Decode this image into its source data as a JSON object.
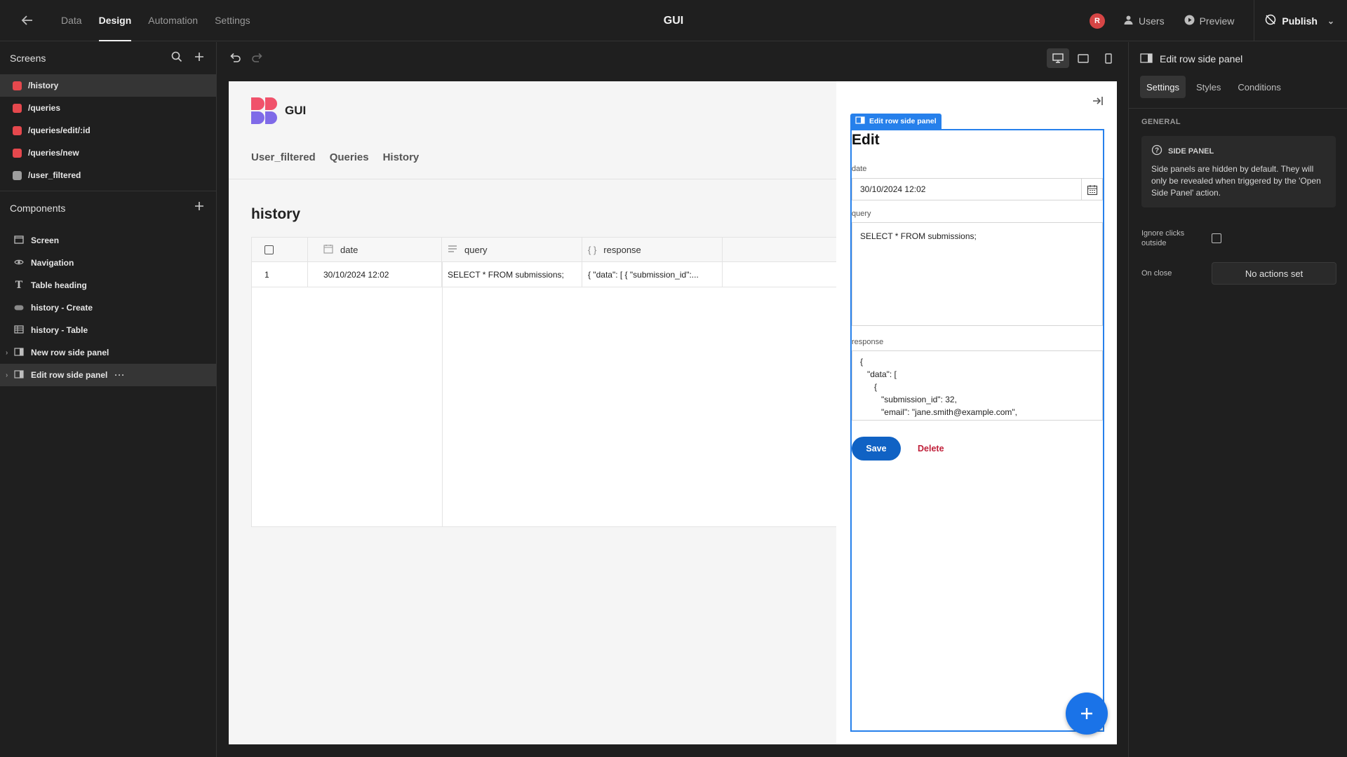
{
  "topbar": {
    "tabs": [
      "Data",
      "Design",
      "Automation",
      "Settings"
    ],
    "active_tab": "Design",
    "app_title": "GUI",
    "avatar_initial": "R",
    "users_label": "Users",
    "preview_label": "Preview",
    "publish_label": "Publish"
  },
  "left": {
    "screens_title": "Screens",
    "screens": [
      {
        "label": "/history",
        "color": "#e5484d",
        "active": true
      },
      {
        "label": "/queries",
        "color": "#e5484d",
        "active": false
      },
      {
        "label": "/queries/edit/:id",
        "color": "#e5484d",
        "active": false
      },
      {
        "label": "/queries/new",
        "color": "#e5484d",
        "active": false
      },
      {
        "label": "/user_filtered",
        "color": "#9e9e9e",
        "active": false
      }
    ],
    "components_title": "Components",
    "components": [
      {
        "label": "Screen",
        "icon": "screen-icon"
      },
      {
        "label": "Navigation",
        "icon": "eye-icon"
      },
      {
        "label": "Table heading",
        "icon": "text-icon"
      },
      {
        "label": "history - Create",
        "icon": "button-icon"
      },
      {
        "label": "history - Table",
        "icon": "table-icon"
      },
      {
        "label": "New row side panel",
        "icon": "panel-icon"
      },
      {
        "label": "Edit row side panel",
        "icon": "panel-icon"
      }
    ]
  },
  "app": {
    "brand": "GUI",
    "nav": [
      "User_filtered",
      "Queries",
      "History"
    ],
    "page_title": "history",
    "table": {
      "columns": [
        "date",
        "query",
        "response"
      ],
      "rows": [
        {
          "index": "1",
          "date": "30/10/2024 12:02",
          "query": "SELECT * FROM submissions;",
          "response": "{ \"data\": [ { \"submission_id\":..."
        }
      ]
    }
  },
  "panel": {
    "tag": "Edit row side panel",
    "title": "Edit",
    "date_label": "date",
    "date_value": "30/10/2024 12:02",
    "query_label": "query",
    "query_value": "SELECT * FROM submissions;",
    "response_label": "response",
    "response_value": "{\n   \"data\": [\n      {\n         \"submission_id\": 32,\n         \"email\": \"jane.smith@example.com\",",
    "save_label": "Save",
    "delete_label": "Delete"
  },
  "right": {
    "title": "Edit row side panel",
    "tabs": [
      "Settings",
      "Styles",
      "Conditions"
    ],
    "section": "GENERAL",
    "info_title": "SIDE PANEL",
    "info_text": "Side panels are hidden by default. They will only be revealed when triggered by the 'Open Side Panel' action.",
    "ignore_clicks_label": "Ignore clicks outside",
    "on_close_label": "On close",
    "on_close_value": "No actions set"
  },
  "colors": {
    "accent": "#2680eb",
    "save": "#1062c4",
    "delete": "#c0203a",
    "fab": "#1a73e8"
  }
}
